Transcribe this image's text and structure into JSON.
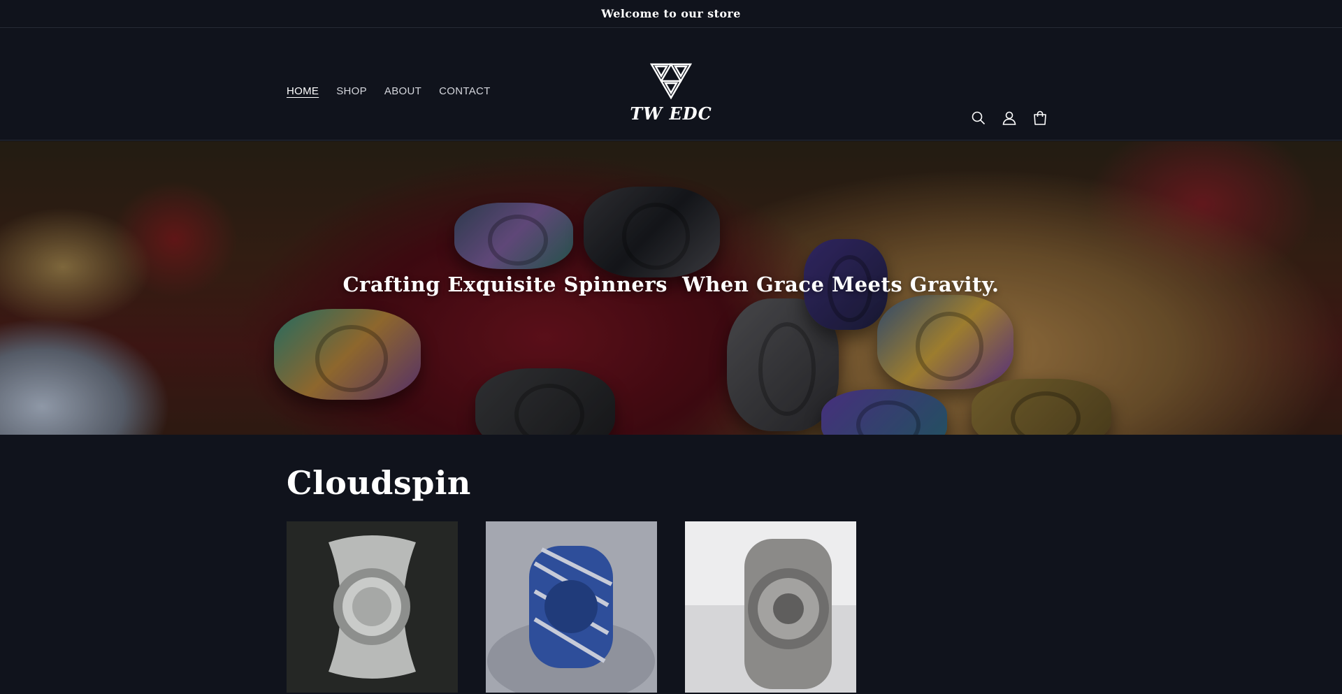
{
  "announcement": {
    "text": "Welcome to our store"
  },
  "header": {
    "nav": [
      {
        "label": "HOME",
        "active": true
      },
      {
        "label": "SHOP",
        "active": false
      },
      {
        "label": "ABOUT",
        "active": false
      },
      {
        "label": "CONTACT",
        "active": false
      }
    ],
    "logo_text": "TW EDC",
    "icons": [
      "search-icon",
      "account-icon",
      "cart-icon"
    ]
  },
  "hero": {
    "title": "Crafting Exquisite Spinners  When Grace Meets Gravity."
  },
  "collection": {
    "title": "Cloudspin",
    "products": [
      {
        "image": "silver-spinner-dark-background"
      },
      {
        "image": "blue-damascus-spinner-gray-fabric"
      },
      {
        "image": "engraved-silver-spinner-white-box"
      }
    ]
  },
  "colors": {
    "background": "#10131c",
    "border": "#262a35",
    "text": "#ffffff"
  }
}
